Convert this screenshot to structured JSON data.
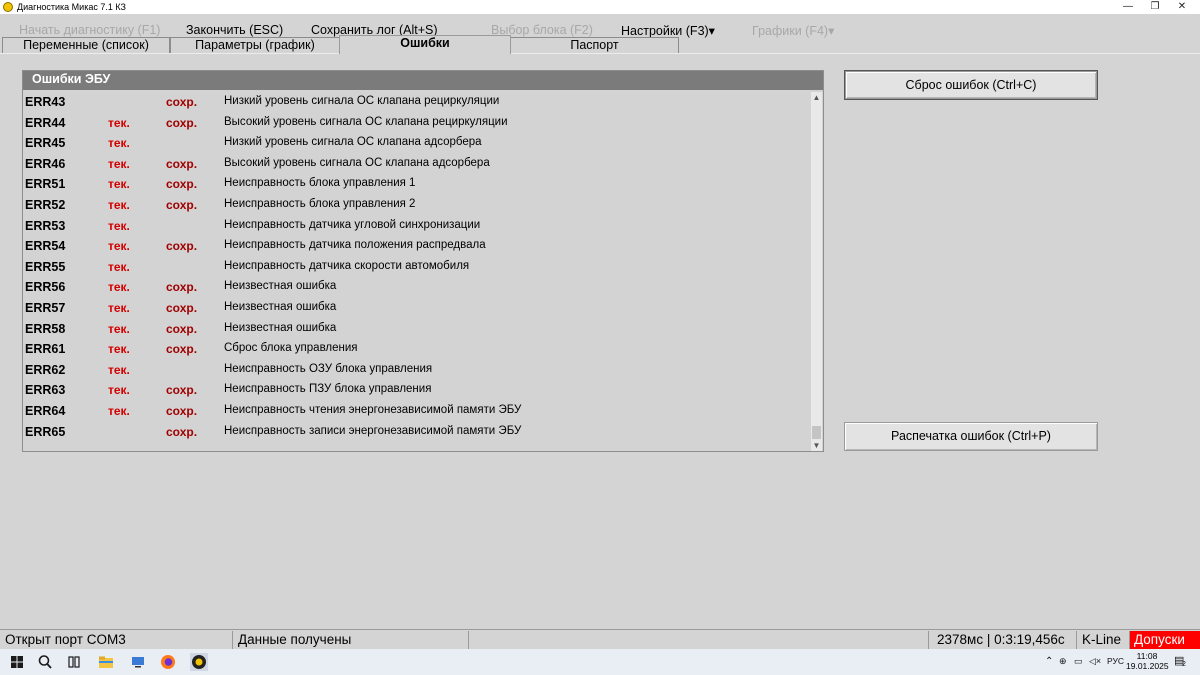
{
  "window": {
    "title": "Диагностика Микас 7.1 КЗ",
    "minimize": "—",
    "restore": "❐",
    "close": "✕"
  },
  "menu": {
    "start_diag": "Начать диагностику (F1)",
    "finish": "Закончить (ESC)",
    "save_log": "Сохранить лог (Alt+S)",
    "select_block": "Выбор блока (F2)",
    "settings": "Настройки (F3)▾",
    "graphs": "Графики (F4)▾"
  },
  "tabs": {
    "variables": "Переменные (список)",
    "params": "Параметры (график)",
    "errors": "Ошибки",
    "passport": "Паспорт"
  },
  "errors_panel": {
    "title": "Ошибки ЭБУ",
    "rows": [
      {
        "code": "ERR43",
        "current": "",
        "saved": "сохр.",
        "desc": "Низкий уровень сигнала ОС клапана рециркуляции"
      },
      {
        "code": "ERR44",
        "current": "тек.",
        "saved": "сохр.",
        "desc": "Высокий уровень сигнала ОС клапана рециркуляции"
      },
      {
        "code": "ERR45",
        "current": "тек.",
        "saved": "",
        "desc": "Низкий уровень сигнала ОС клапана адсорбера"
      },
      {
        "code": "ERR46",
        "current": "тек.",
        "saved": "сохр.",
        "desc": "Высокий уровень сигнала ОС клапана адсорбера"
      },
      {
        "code": "ERR51",
        "current": "тек.",
        "saved": "сохр.",
        "desc": "Неисправность блока управления 1"
      },
      {
        "code": "ERR52",
        "current": "тек.",
        "saved": "сохр.",
        "desc": "Неисправность блока управления 2"
      },
      {
        "code": "ERR53",
        "current": "тек.",
        "saved": "",
        "desc": "Неисправность датчика угловой синхронизации"
      },
      {
        "code": "ERR54",
        "current": "тек.",
        "saved": "сохр.",
        "desc": "Неисправность датчика положения распредвала"
      },
      {
        "code": "ERR55",
        "current": "тек.",
        "saved": "",
        "desc": "Неисправность датчика скорости автомобиля"
      },
      {
        "code": "ERR56",
        "current": "тек.",
        "saved": "сохр.",
        "desc": "Неизвестная ошибка"
      },
      {
        "code": "ERR57",
        "current": "тек.",
        "saved": "сохр.",
        "desc": "Неизвестная ошибка"
      },
      {
        "code": "ERR58",
        "current": "тек.",
        "saved": "сохр.",
        "desc": "Неизвестная ошибка"
      },
      {
        "code": "ERR61",
        "current": "тек.",
        "saved": "сохр.",
        "desc": "Сброс блока управления"
      },
      {
        "code": "ERR62",
        "current": "тек.",
        "saved": "",
        "desc": "Неисправность ОЗУ блока управления"
      },
      {
        "code": "ERR63",
        "current": "тек.",
        "saved": "сохр.",
        "desc": "Неисправность ПЗУ блока управления"
      },
      {
        "code": "ERR64",
        "current": "тек.",
        "saved": "сохр.",
        "desc": "Неисправность чтения энергонезависимой памяти ЭБУ"
      },
      {
        "code": "ERR65",
        "current": "",
        "saved": "сохр.",
        "desc": "Неисправность записи энергонезависимой памяти ЭБУ"
      }
    ]
  },
  "buttons": {
    "reset_errors": "Сброс ошибок (Ctrl+C)",
    "print_errors": "Распечатка ошибок (Ctrl+P)"
  },
  "status": {
    "port": "Открыт порт COM3",
    "data": "Данные получены",
    "timing": "2378мс | 0:3:19,456с",
    "protocol": "K-Line",
    "tolerances": "Допуски"
  },
  "taskbar": {
    "lang": "РУС",
    "time": "11:08",
    "date": "19.01.2025",
    "notifications": "2"
  },
  "colors": {
    "current_text": "#d40000",
    "saved_text": "#a00000",
    "header_bg": "#7b7b7b",
    "alert_bg": "#ff0000"
  }
}
